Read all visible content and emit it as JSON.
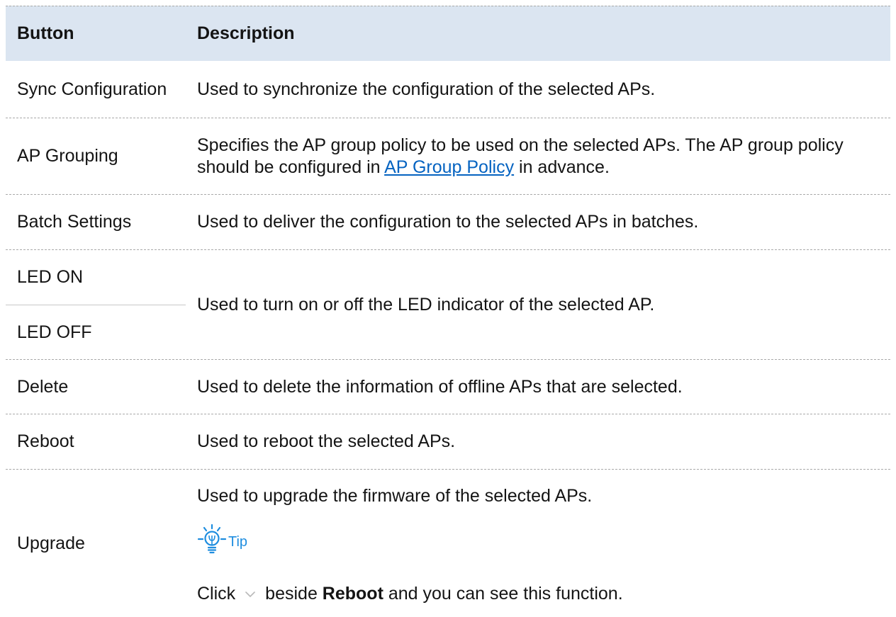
{
  "table": {
    "headers": {
      "button": "Button",
      "description": "Description"
    },
    "sync": {
      "button": "Sync Configuration",
      "description": "Used to synchronize the configuration of the selected APs."
    },
    "ap_grouping": {
      "button": "AP Grouping",
      "description_line1": "Specifies the AP group policy to be used on the selected APs. The AP group policy",
      "description_line2_before_link": "should be configured in",
      "description_link": "AP Group Policy",
      "description_line2_after_link": "in advance."
    },
    "batch_settings": {
      "button": "Batch Settings",
      "description": "Used to deliver the configuration to the selected APs in batches."
    },
    "led": {
      "buttons": [
        "LED ON",
        "LED OFF"
      ],
      "description": "Used to turn on or off the LED indicator of the selected AP."
    },
    "delete": {
      "button": "Delete",
      "description": "Used to delete the information of offline APs that are selected."
    },
    "reboot": {
      "button": "Reboot",
      "description": "Used to reboot the selected APs."
    },
    "upgrade": {
      "button": "Upgrade",
      "description": "Used to upgrade the firmware of the selected APs.",
      "tip": {
        "icon": "lightbulb-icon",
        "label": "Tip",
        "text_before_icon": "Click",
        "inline_icon": "chevron-down-icon",
        "text_after_icon": "beside",
        "bold_text": "Reboot",
        "text_end": "and you can see this function."
      }
    }
  },
  "colors": {
    "header_background": "#dbe5f1",
    "link": "#0563c1",
    "tip_accent": "#1e8ddf"
  }
}
